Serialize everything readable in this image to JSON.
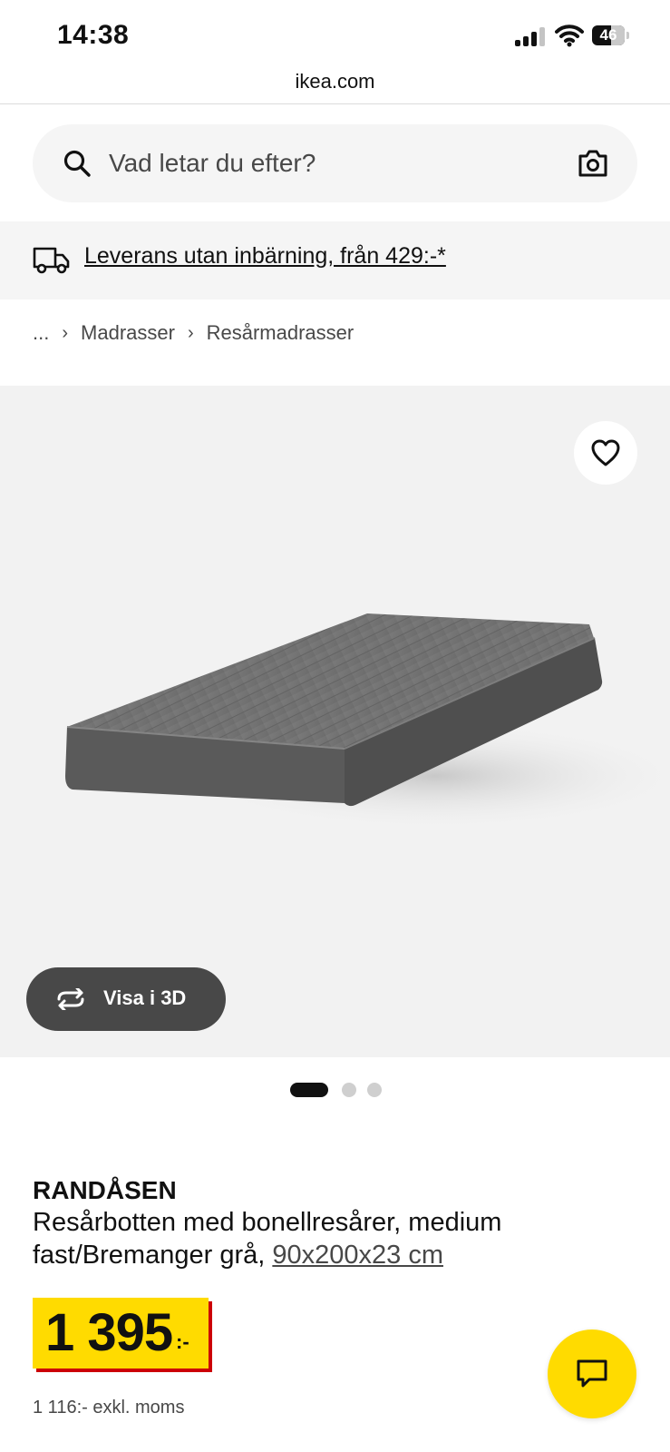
{
  "status_bar": {
    "time": "14:38",
    "battery": "46"
  },
  "browser": {
    "url": "ikea.com"
  },
  "search": {
    "placeholder": "Vad letar du efter?"
  },
  "delivery": {
    "text": "Leverans utan inbärning, från 429:-*"
  },
  "breadcrumb": {
    "ellipsis": "...",
    "items": [
      "Madrasser",
      "Resårmadrasser"
    ]
  },
  "gallery": {
    "view_3d_label": "Visa i 3D",
    "image_count": 3,
    "active_index": 0
  },
  "product": {
    "name": "RANDÅSEN",
    "description": "Resårbotten med bonellresårer, medium fast/Bremanger grå,",
    "size_link": "90x200x23 cm",
    "price": "1 395",
    "price_suffix": ":-",
    "price_excl_vat": "1 116:- exkl. moms"
  },
  "colors": {
    "ikea_yellow": "#ffdb00",
    "ikea_red": "#cc0008",
    "dark_gray": "#484848",
    "light_gray": "#f5f5f5"
  }
}
